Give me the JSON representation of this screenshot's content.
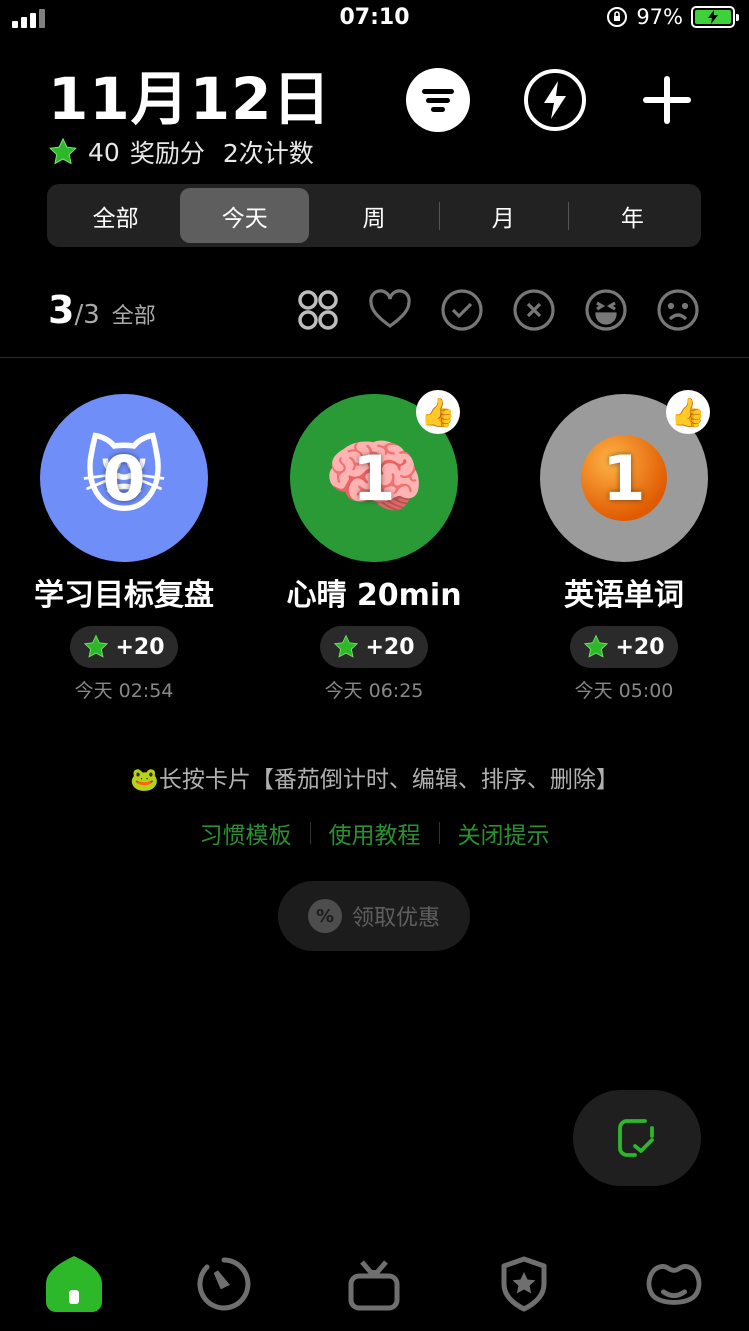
{
  "status_bar": {
    "time": "07:10",
    "battery": "97%"
  },
  "header": {
    "date": "11月12日",
    "points_value": "40",
    "points_label": "奖励分",
    "count_text": "2次计数"
  },
  "tabs": [
    "全部",
    "今天",
    "周",
    "月",
    "年"
  ],
  "active_tab": "今天",
  "summary": {
    "done": "3",
    "total": "/3",
    "label": "全部"
  },
  "filters": [
    "all-grid-icon",
    "heart-icon",
    "check-circle-icon",
    "x-circle-icon",
    "laugh-face-icon",
    "sad-face-icon"
  ],
  "habits": [
    {
      "emoji": "😿",
      "count": "0",
      "name": "学习目标复盘",
      "reward": "+20",
      "time": "今天 02:54",
      "color": "#6f8ef8",
      "liked": false
    },
    {
      "emoji": "🧠",
      "count": "1",
      "name": "心晴 20min",
      "reward": "+20",
      "time": "今天 06:25",
      "color": "#2a9a37",
      "liked": true
    },
    {
      "emoji": "🟠",
      "count": "1",
      "name": "英语单词",
      "reward": "+20",
      "time": "今天 05:00",
      "color": "#9b9b9b",
      "liked": true
    }
  ],
  "tip": {
    "emoji": "🐸",
    "text": "长按卡片【番茄倒计时、编辑、排序、删除】",
    "links": [
      "习惯模板",
      "使用教程",
      "关闭提示"
    ]
  },
  "promo": {
    "label": "领取优惠",
    "badge": "%"
  },
  "colors": {
    "accent_green": "#2db82a",
    "link_green": "#2a8f2f"
  }
}
